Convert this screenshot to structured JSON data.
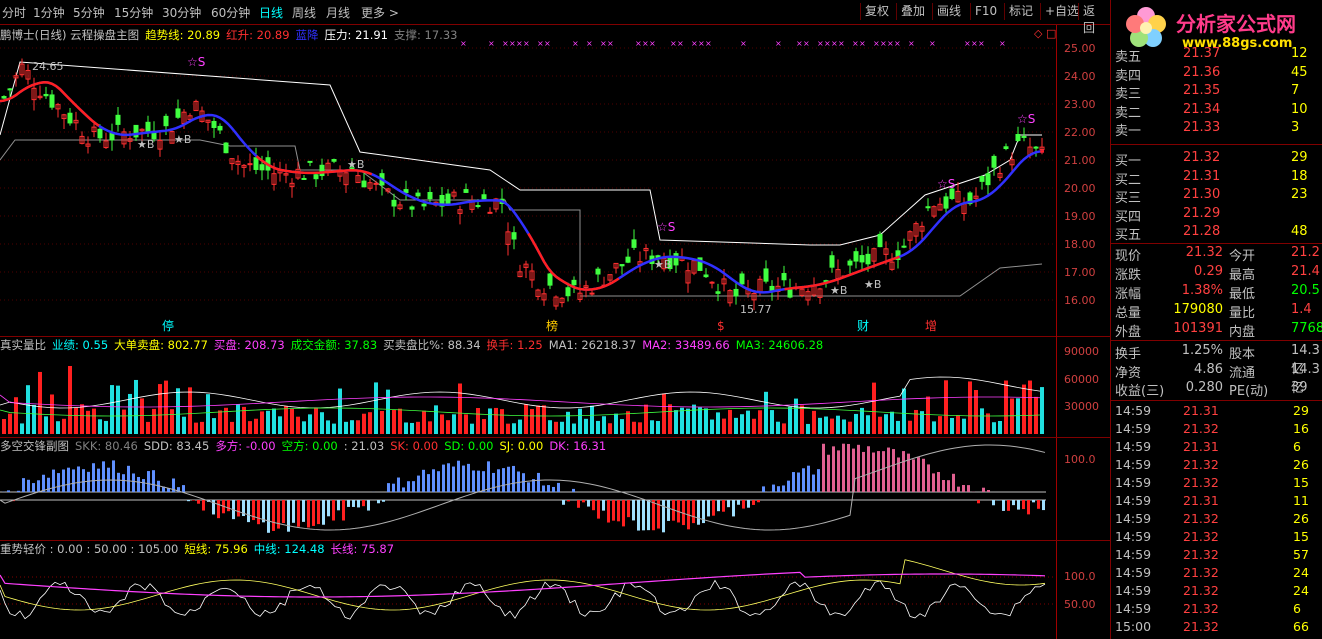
{
  "toolbar": {
    "periods": [
      "分时",
      "1分钟",
      "5分钟",
      "15分钟",
      "30分钟",
      "60分钟",
      "日线",
      "周线",
      "月线",
      "更多 >"
    ],
    "active_period": "日线",
    "buttons": [
      "复权",
      "叠加",
      "画线",
      "F10",
      "标记",
      "+自选",
      "返回"
    ]
  },
  "logo": {
    "title": "分析家公式网",
    "url": "www.88gs.com"
  },
  "main_chart": {
    "legend": [
      {
        "text": "鹏博士(日线) 云程操盘主图",
        "color": "#c0c0c0"
      },
      {
        "text": "趋势线: 20.89",
        "color": "#ffff00"
      },
      {
        "text": "红升: 20.89",
        "color": "#ff3030"
      },
      {
        "text": "蓝降",
        "color": "#3030ff"
      },
      {
        "text": "压力: 21.91",
        "color": "#ffffff"
      },
      {
        "text": "支撑: 17.33",
        "color": "#808080"
      }
    ],
    "y_ticks": [
      "25.00",
      "24.00",
      "23.00",
      "22.00",
      "21.00",
      "20.00",
      "19.00",
      "18.00",
      "17.00",
      "16.00"
    ],
    "annotations": {
      "high": "24.65",
      "low": "15.77",
      "sell": "☆S",
      "buy": "★B"
    },
    "event_marks": [
      "停",
      "榜",
      "$",
      "财",
      "增"
    ]
  },
  "volume_chart": {
    "legend": [
      {
        "text": "真实量比",
        "color": "#c0c0c0"
      },
      {
        "text": "业绩: 0.55",
        "color": "#00ffff"
      },
      {
        "text": "大单卖盘: 802.77",
        "color": "#ffff00"
      },
      {
        "text": "买盘: 208.73",
        "color": "#ff40ff"
      },
      {
        "text": "成交金额: 37.83",
        "color": "#00ff00"
      },
      {
        "text": "买卖盘比%: 88.34",
        "color": "#c0c0c0"
      },
      {
        "text": "换手: 1.25",
        "color": "#ff3030"
      },
      {
        "text": "MA1: 26218.37",
        "color": "#c0c0c0"
      },
      {
        "text": "MA2: 33489.66",
        "color": "#ff40ff"
      },
      {
        "text": "MA3: 24606.28",
        "color": "#00ff00"
      }
    ],
    "y_ticks": [
      "90000",
      "60000",
      "30000"
    ]
  },
  "duokong_chart": {
    "legend": [
      {
        "text": "多空交锋副图",
        "color": "#c0c0c0"
      },
      {
        "text": "SKK: 80.46",
        "color": "#808080"
      },
      {
        "text": "SDD: 83.45",
        "color": "#c0c0c0"
      },
      {
        "text": "多方: -0.00",
        "color": "#ff40ff"
      },
      {
        "text": "空方: 0.00",
        "color": "#00ff00"
      },
      {
        "text": ": 21.03",
        "color": "#c0c0c0"
      },
      {
        "text": "SK: 0.00",
        "color": "#ff3030"
      },
      {
        "text": "SD: 0.00",
        "color": "#00ff00"
      },
      {
        "text": "SJ: 0.00",
        "color": "#ffff00"
      },
      {
        "text": "DK: 16.31",
        "color": "#ff40ff"
      }
    ],
    "y_ticks": [
      "100.0"
    ]
  },
  "trend_chart": {
    "legend": [
      {
        "text": "重势轻价 : 0.00 : 50.00 : 105.00",
        "color": "#c0c0c0"
      },
      {
        "text": "短线: 75.96",
        "color": "#ffff00"
      },
      {
        "text": "中线: 124.48",
        "color": "#00ffff"
      },
      {
        "text": "长线: 75.87",
        "color": "#ff40ff"
      }
    ],
    "y_ticks": [
      "100.0",
      "50.00"
    ]
  },
  "order_book": {
    "sell": [
      {
        "label": "卖五",
        "price": "21.37",
        "vol": "12"
      },
      {
        "label": "卖四",
        "price": "21.36",
        "vol": "45"
      },
      {
        "label": "卖三",
        "price": "21.35",
        "vol": "7"
      },
      {
        "label": "卖二",
        "price": "21.34",
        "vol": "10"
      },
      {
        "label": "卖一",
        "price": "21.33",
        "vol": "3"
      }
    ],
    "buy": [
      {
        "label": "买一",
        "price": "21.32",
        "vol": "29"
      },
      {
        "label": "买二",
        "price": "21.31",
        "vol": "18"
      },
      {
        "label": "买三",
        "price": "21.30",
        "vol": "23"
      },
      {
        "label": "买四",
        "price": "21.29",
        "vol": ""
      },
      {
        "label": "买五",
        "price": "21.28",
        "vol": "48"
      }
    ]
  },
  "quote": [
    {
      "k1": "现价",
      "v1": "21.32",
      "k2": "今开",
      "v2": "21.2"
    },
    {
      "k1": "涨跌",
      "v1": "0.29",
      "k2": "最高",
      "v2": "21.4"
    },
    {
      "k1": "涨幅",
      "v1": "1.38%",
      "k2": "最低",
      "v2": "20.5"
    },
    {
      "k1": "总量",
      "v1": "179080",
      "k2": "量比",
      "v2": "1.4"
    },
    {
      "k1": "外盘",
      "v1": "101391",
      "k2": "内盘",
      "v2": "7768"
    }
  ],
  "fundamentals": [
    {
      "k1": "换手",
      "v1": "1.25%",
      "k2": "股本",
      "v2": "14.3亿"
    },
    {
      "k1": "净资",
      "v1": "4.86",
      "k2": "流通",
      "v2": "14.3亿"
    },
    {
      "k1": "收益(三)",
      "v1": "0.280",
      "k2": "PE(动)",
      "v2": "39"
    }
  ],
  "ticks": [
    {
      "t": "14:59",
      "p": "21.31",
      "v": "29"
    },
    {
      "t": "14:59",
      "p": "21.32",
      "v": "16"
    },
    {
      "t": "14:59",
      "p": "21.31",
      "v": "6"
    },
    {
      "t": "14:59",
      "p": "21.32",
      "v": "26"
    },
    {
      "t": "14:59",
      "p": "21.32",
      "v": "15"
    },
    {
      "t": "14:59",
      "p": "21.31",
      "v": "11"
    },
    {
      "t": "14:59",
      "p": "21.32",
      "v": "26"
    },
    {
      "t": "14:59",
      "p": "21.32",
      "v": "15"
    },
    {
      "t": "14:59",
      "p": "21.32",
      "v": "57"
    },
    {
      "t": "14:59",
      "p": "21.32",
      "v": "24"
    },
    {
      "t": "14:59",
      "p": "21.32",
      "v": "24"
    },
    {
      "t": "14:59",
      "p": "21.32",
      "v": "6"
    },
    {
      "t": "15:00",
      "p": "21.32",
      "v": "66"
    }
  ]
}
